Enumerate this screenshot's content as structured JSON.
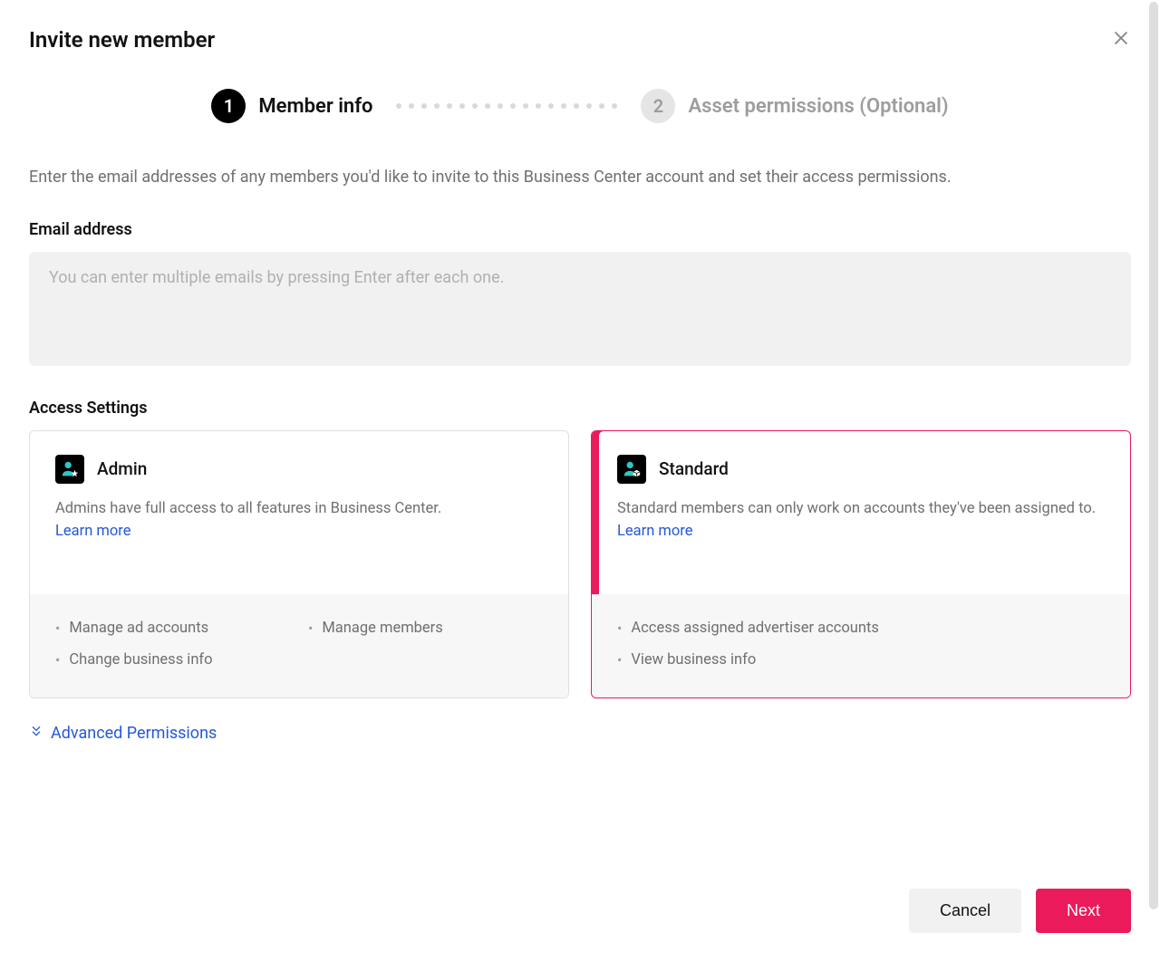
{
  "title": "Invite new member",
  "stepper": {
    "step1": {
      "num": "1",
      "label": "Member info"
    },
    "step2": {
      "num": "2",
      "label": "Asset permissions (Optional)"
    }
  },
  "instruction": "Enter the email addresses of any members you'd like to invite to this Business Center account and set their access permissions.",
  "email": {
    "label": "Email address",
    "placeholder": "You can enter multiple emails by pressing Enter after each one."
  },
  "access": {
    "label": "Access Settings",
    "cards": {
      "admin": {
        "title": "Admin",
        "desc": "Admins have full access to all features in Business Center. ",
        "learn_more": "Learn more",
        "perms": [
          "Manage ad accounts",
          "Manage members",
          "Change business info"
        ]
      },
      "standard": {
        "title": "Standard",
        "desc": "Standard members can only work on accounts they've been assigned to. ",
        "learn_more": "Learn more",
        "perms": [
          "Access assigned advertiser accounts",
          "View business info"
        ]
      }
    }
  },
  "advanced_label": "Advanced Permissions",
  "footer": {
    "cancel": "Cancel",
    "next": "Next"
  }
}
